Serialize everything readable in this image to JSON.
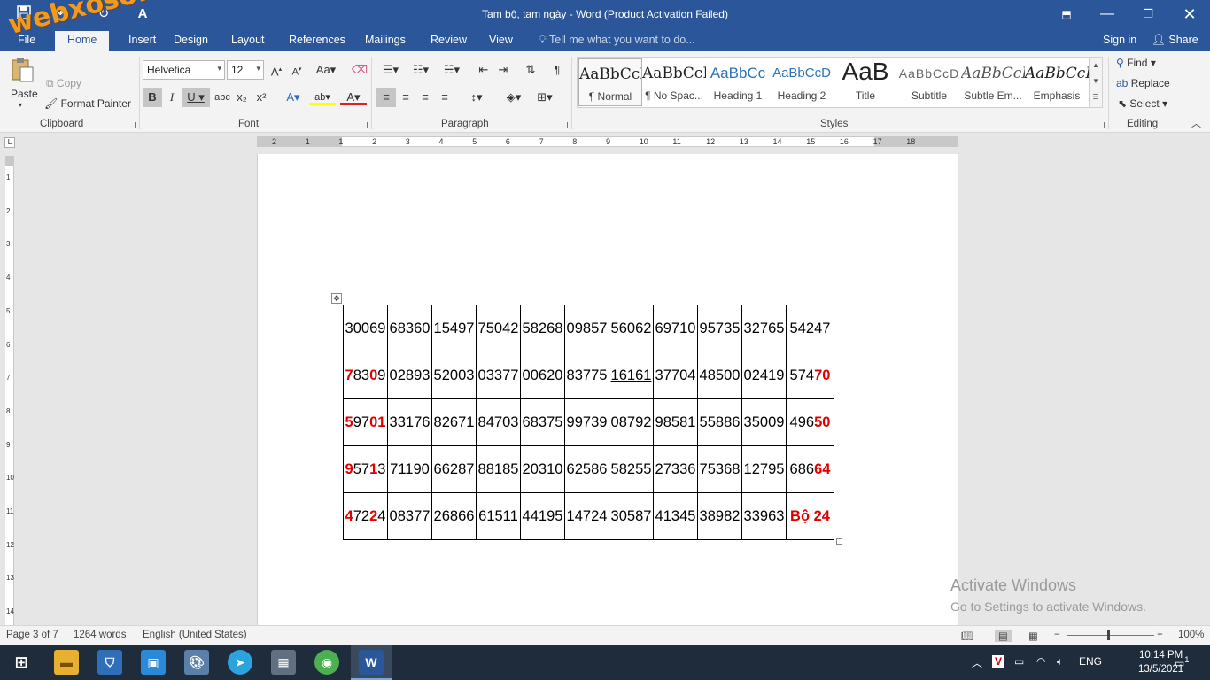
{
  "window": {
    "title": "Tam bộ, tam ngày - Word (Product Activation Failed)",
    "minimize_icon": "minimize-icon",
    "restore_icon": "restore-icon",
    "close_icon": "close-icon"
  },
  "quick_access": {
    "save_icon": "save-icon",
    "undo_icon": "undo-icon",
    "redo_icon": "redo-icon",
    "font_color_icon": "font-color-icon"
  },
  "tabs": [
    "File",
    "Home",
    "Insert",
    "Design",
    "Layout",
    "References",
    "Mailings",
    "Review",
    "View"
  ],
  "tell_me": "Tell me what you want to do...",
  "sign_in": "Sign in",
  "share": "Share",
  "clipboard": {
    "paste": "Paste",
    "copy": "Copy",
    "format_painter": "Format Painter",
    "label": "Clipboard"
  },
  "font": {
    "name": "Helvetica",
    "size": "12",
    "label": "Font",
    "bold": "B",
    "italic": "I",
    "underline": "U",
    "strike": "abc",
    "sub": "x₂",
    "sup": "x²"
  },
  "paragraph": {
    "label": "Paragraph"
  },
  "styles": {
    "label": "Styles",
    "items": [
      {
        "preview": "AaBbCcI",
        "name": "¶ Normal"
      },
      {
        "preview": "AaBbCcI",
        "name": "¶ No Spac..."
      },
      {
        "preview": "AaBbCc",
        "name": "Heading 1"
      },
      {
        "preview": "AaBbCcD",
        "name": "Heading 2"
      },
      {
        "preview": "AaB",
        "name": "Title"
      },
      {
        "preview": "AaBbCcD",
        "name": "Subtitle"
      },
      {
        "preview": "AaBbCcI",
        "name": "Subtle Em..."
      },
      {
        "preview": "AaBbCcI",
        "name": "Emphasis"
      }
    ]
  },
  "editing": {
    "find": "Find",
    "replace": "Replace",
    "select": "Select",
    "label": "Editing"
  },
  "ruler": {
    "h_numbers": [
      "2",
      "1",
      "1",
      "2",
      "3",
      "4",
      "5",
      "6",
      "7",
      "8",
      "9",
      "10",
      "11",
      "12",
      "13",
      "14",
      "15",
      "16",
      "17",
      "18"
    ],
    "v_numbers": [
      "1",
      "2",
      "3",
      "4",
      "5",
      "6",
      "7",
      "8",
      "9",
      "10",
      "11",
      "12",
      "13",
      "14"
    ]
  },
  "table": {
    "rows": [
      [
        {
          "parts": [
            {
              "t": "30069"
            }
          ]
        },
        {
          "parts": [
            {
              "t": "68360"
            }
          ]
        },
        {
          "parts": [
            {
              "t": "15497"
            }
          ]
        },
        {
          "parts": [
            {
              "t": "75042"
            }
          ]
        },
        {
          "parts": [
            {
              "t": "58268"
            }
          ]
        },
        {
          "parts": [
            {
              "t": "09857"
            }
          ]
        },
        {
          "parts": [
            {
              "t": "56062"
            }
          ]
        },
        {
          "parts": [
            {
              "t": "69710"
            }
          ]
        },
        {
          "parts": [
            {
              "t": "95735"
            }
          ]
        },
        {
          "parts": [
            {
              "t": "32765"
            }
          ]
        },
        {
          "parts": [
            {
              "t": "54247"
            }
          ]
        }
      ],
      [
        {
          "parts": [
            {
              "t": "7",
              "red": true
            },
            {
              "t": "83"
            },
            {
              "t": "0",
              "red": true
            },
            {
              "t": "9"
            }
          ]
        },
        {
          "parts": [
            {
              "t": "02893"
            }
          ]
        },
        {
          "parts": [
            {
              "t": "52003"
            }
          ]
        },
        {
          "parts": [
            {
              "t": "03377"
            }
          ]
        },
        {
          "parts": [
            {
              "t": "00620"
            }
          ]
        },
        {
          "parts": [
            {
              "t": "83775"
            }
          ]
        },
        {
          "parts": [
            {
              "t": "16161",
              "u": true
            }
          ]
        },
        {
          "parts": [
            {
              "t": "37704"
            }
          ]
        },
        {
          "parts": [
            {
              "t": "48500"
            }
          ]
        },
        {
          "parts": [
            {
              "t": "02419"
            }
          ]
        },
        {
          "parts": [
            {
              "t": "574"
            },
            {
              "t": "70",
              "red": true
            }
          ]
        }
      ],
      [
        {
          "parts": [
            {
              "t": "5",
              "red": true
            },
            {
              "t": "97"
            },
            {
              "t": "01",
              "red": true
            }
          ]
        },
        {
          "parts": [
            {
              "t": "33176"
            }
          ]
        },
        {
          "parts": [
            {
              "t": "82671"
            }
          ]
        },
        {
          "parts": [
            {
              "t": "84703"
            }
          ]
        },
        {
          "parts": [
            {
              "t": "68375"
            }
          ]
        },
        {
          "parts": [
            {
              "t": "99739"
            }
          ]
        },
        {
          "parts": [
            {
              "t": "08792"
            }
          ]
        },
        {
          "parts": [
            {
              "t": "98581"
            }
          ]
        },
        {
          "parts": [
            {
              "t": "55886"
            }
          ]
        },
        {
          "parts": [
            {
              "t": "35009"
            }
          ]
        },
        {
          "parts": [
            {
              "t": "496"
            },
            {
              "t": "50",
              "red": true
            }
          ]
        }
      ],
      [
        {
          "parts": [
            {
              "t": "9",
              "red": true
            },
            {
              "t": "57"
            },
            {
              "t": "1",
              "red": true
            },
            {
              "t": "3"
            }
          ]
        },
        {
          "parts": [
            {
              "t": "71190"
            }
          ]
        },
        {
          "parts": [
            {
              "t": "66287"
            }
          ]
        },
        {
          "parts": [
            {
              "t": "88185"
            }
          ]
        },
        {
          "parts": [
            {
              "t": "20310"
            }
          ]
        },
        {
          "parts": [
            {
              "t": "62586"
            }
          ]
        },
        {
          "parts": [
            {
              "t": "58255"
            }
          ]
        },
        {
          "parts": [
            {
              "t": "27336"
            }
          ]
        },
        {
          "parts": [
            {
              "t": "75368"
            }
          ]
        },
        {
          "parts": [
            {
              "t": "12795"
            }
          ]
        },
        {
          "parts": [
            {
              "t": "686"
            },
            {
              "t": "64",
              "red": true
            }
          ]
        }
      ],
      [
        {
          "parts": [
            {
              "t": "4",
              "red": true,
              "u": true
            },
            {
              "t": "72"
            },
            {
              "t": "2",
              "red": true,
              "u": true
            },
            {
              "t": "4"
            }
          ]
        },
        {
          "parts": [
            {
              "t": "08377"
            }
          ]
        },
        {
          "parts": [
            {
              "t": "26866"
            }
          ]
        },
        {
          "parts": [
            {
              "t": "61511"
            }
          ]
        },
        {
          "parts": [
            {
              "t": "44195"
            }
          ]
        },
        {
          "parts": [
            {
              "t": "14724"
            }
          ]
        },
        {
          "parts": [
            {
              "t": "30587"
            }
          ]
        },
        {
          "parts": [
            {
              "t": "41345"
            }
          ]
        },
        {
          "parts": [
            {
              "t": "38982"
            }
          ]
        },
        {
          "parts": [
            {
              "t": "33963"
            }
          ]
        },
        {
          "parts": [
            {
              "t": "Bộ 24 ",
              "red": true,
              "u": true
            }
          ]
        }
      ]
    ]
  },
  "activate": {
    "line1": "Activate Windows",
    "line2": "Go to Settings to activate Windows."
  },
  "status": {
    "page": "Page 3 of 7",
    "words": "1264 words",
    "language": "English (United States)",
    "zoom": "100%"
  },
  "taskbar": {
    "lang": "ENG",
    "time": "10:14 PM",
    "date": "13/5/2021",
    "notifications": "1"
  },
  "watermark": "webxoso.net"
}
